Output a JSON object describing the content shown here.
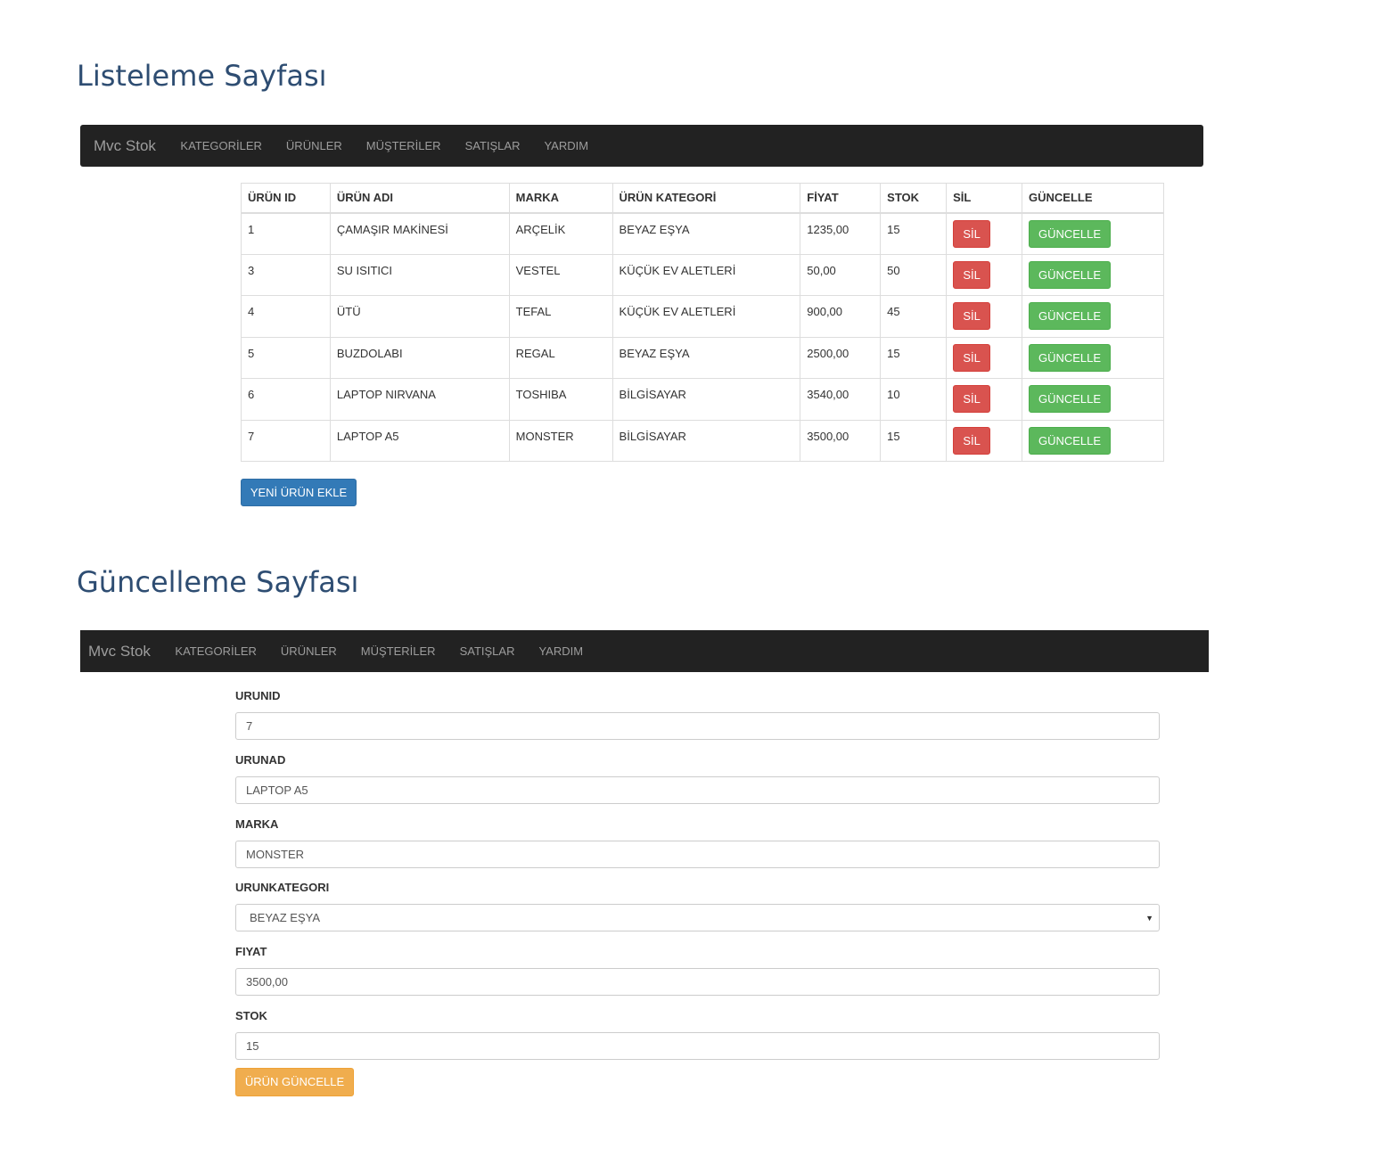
{
  "headings": {
    "list": "Listeleme Sayfası",
    "update": "Güncelleme Sayfası"
  },
  "navbar": {
    "brand": "Mvc Stok",
    "items": [
      "KATEGORİLER",
      "ÜRÜNLER",
      "MÜŞTERİLER",
      "SATIŞLAR",
      "YARDIM"
    ]
  },
  "table": {
    "headers": [
      "ÜRÜN ID",
      "ÜRÜN ADI",
      "MARKA",
      "ÜRÜN KATEGORİ",
      "FİYAT",
      "STOK",
      "SİL",
      "GÜNCELLE"
    ],
    "rows": [
      {
        "id": "1",
        "name": "ÇAMAŞIR MAKİNESİ",
        "brand": "ARÇELİK",
        "category": "BEYAZ EŞYA",
        "price": "1235,00",
        "stock": "15"
      },
      {
        "id": "3",
        "name": "SU ISITICI",
        "brand": "VESTEL",
        "category": "KÜÇÜK EV ALETLERİ",
        "price": "50,00",
        "stock": "50"
      },
      {
        "id": "4",
        "name": "ÜTÜ",
        "brand": "TEFAL",
        "category": "KÜÇÜK EV ALETLERİ",
        "price": "900,00",
        "stock": "45"
      },
      {
        "id": "5",
        "name": "BUZDOLABI",
        "brand": "REGAL",
        "category": "BEYAZ EŞYA",
        "price": "2500,00",
        "stock": "15"
      },
      {
        "id": "6",
        "name": "LAPTOP NIRVANA",
        "brand": "TOSHIBA",
        "category": "BİLGİSAYAR",
        "price": "3540,00",
        "stock": "10"
      },
      {
        "id": "7",
        "name": "LAPTOP A5",
        "brand": "MONSTER",
        "category": "BİLGİSAYAR",
        "price": "3500,00",
        "stock": "15"
      }
    ],
    "delete_label": "SİL",
    "update_label": "GÜNCELLE"
  },
  "new_product_button": "YENİ ÜRÜN EKLE",
  "form": {
    "fields": [
      {
        "label": "URUNID",
        "value": "7"
      },
      {
        "label": "URUNAD",
        "value": "LAPTOP A5"
      },
      {
        "label": "MARKA",
        "value": "MONSTER"
      },
      {
        "label": "URUNKATEGORI",
        "value": "BEYAZ EŞYA"
      },
      {
        "label": "FIYAT",
        "value": "3500,00"
      },
      {
        "label": "STOK",
        "value": "15"
      }
    ],
    "submit_label": "ÜRÜN GÜNCELLE"
  },
  "colors": {
    "navbar_bg": "#222222",
    "danger": "#d9534f",
    "success": "#5cb85c",
    "primary": "#337ab7",
    "warning": "#f0ad4e",
    "heading": "#2e4d72"
  }
}
